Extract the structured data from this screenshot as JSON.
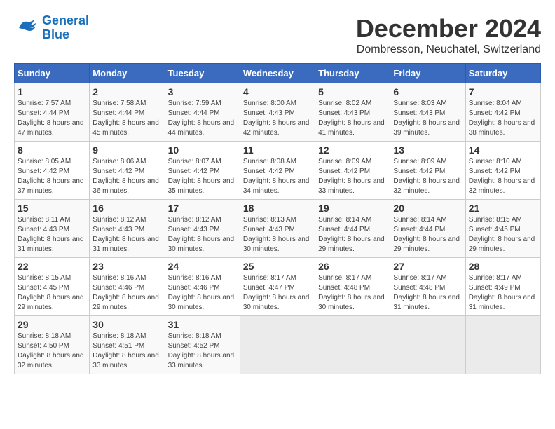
{
  "logo": {
    "line1": "General",
    "line2": "Blue"
  },
  "title": "December 2024",
  "location": "Dombresson, Neuchatel, Switzerland",
  "headers": [
    "Sunday",
    "Monday",
    "Tuesday",
    "Wednesday",
    "Thursday",
    "Friday",
    "Saturday"
  ],
  "weeks": [
    [
      {
        "day": "1",
        "sunrise": "7:57 AM",
        "sunset": "4:44 PM",
        "daylight": "8 hours and 47 minutes."
      },
      {
        "day": "2",
        "sunrise": "7:58 AM",
        "sunset": "4:44 PM",
        "daylight": "8 hours and 45 minutes."
      },
      {
        "day": "3",
        "sunrise": "7:59 AM",
        "sunset": "4:44 PM",
        "daylight": "8 hours and 44 minutes."
      },
      {
        "day": "4",
        "sunrise": "8:00 AM",
        "sunset": "4:43 PM",
        "daylight": "8 hours and 42 minutes."
      },
      {
        "day": "5",
        "sunrise": "8:02 AM",
        "sunset": "4:43 PM",
        "daylight": "8 hours and 41 minutes."
      },
      {
        "day": "6",
        "sunrise": "8:03 AM",
        "sunset": "4:43 PM",
        "daylight": "8 hours and 39 minutes."
      },
      {
        "day": "7",
        "sunrise": "8:04 AM",
        "sunset": "4:42 PM",
        "daylight": "8 hours and 38 minutes."
      }
    ],
    [
      {
        "day": "8",
        "sunrise": "8:05 AM",
        "sunset": "4:42 PM",
        "daylight": "8 hours and 37 minutes."
      },
      {
        "day": "9",
        "sunrise": "8:06 AM",
        "sunset": "4:42 PM",
        "daylight": "8 hours and 36 minutes."
      },
      {
        "day": "10",
        "sunrise": "8:07 AM",
        "sunset": "4:42 PM",
        "daylight": "8 hours and 35 minutes."
      },
      {
        "day": "11",
        "sunrise": "8:08 AM",
        "sunset": "4:42 PM",
        "daylight": "8 hours and 34 minutes."
      },
      {
        "day": "12",
        "sunrise": "8:09 AM",
        "sunset": "4:42 PM",
        "daylight": "8 hours and 33 minutes."
      },
      {
        "day": "13",
        "sunrise": "8:09 AM",
        "sunset": "4:42 PM",
        "daylight": "8 hours and 32 minutes."
      },
      {
        "day": "14",
        "sunrise": "8:10 AM",
        "sunset": "4:42 PM",
        "daylight": "8 hours and 32 minutes."
      }
    ],
    [
      {
        "day": "15",
        "sunrise": "8:11 AM",
        "sunset": "4:43 PM",
        "daylight": "8 hours and 31 minutes."
      },
      {
        "day": "16",
        "sunrise": "8:12 AM",
        "sunset": "4:43 PM",
        "daylight": "8 hours and 31 minutes."
      },
      {
        "day": "17",
        "sunrise": "8:12 AM",
        "sunset": "4:43 PM",
        "daylight": "8 hours and 30 minutes."
      },
      {
        "day": "18",
        "sunrise": "8:13 AM",
        "sunset": "4:43 PM",
        "daylight": "8 hours and 30 minutes."
      },
      {
        "day": "19",
        "sunrise": "8:14 AM",
        "sunset": "4:44 PM",
        "daylight": "8 hours and 29 minutes."
      },
      {
        "day": "20",
        "sunrise": "8:14 AM",
        "sunset": "4:44 PM",
        "daylight": "8 hours and 29 minutes."
      },
      {
        "day": "21",
        "sunrise": "8:15 AM",
        "sunset": "4:45 PM",
        "daylight": "8 hours and 29 minutes."
      }
    ],
    [
      {
        "day": "22",
        "sunrise": "8:15 AM",
        "sunset": "4:45 PM",
        "daylight": "8 hours and 29 minutes."
      },
      {
        "day": "23",
        "sunrise": "8:16 AM",
        "sunset": "4:46 PM",
        "daylight": "8 hours and 29 minutes."
      },
      {
        "day": "24",
        "sunrise": "8:16 AM",
        "sunset": "4:46 PM",
        "daylight": "8 hours and 30 minutes."
      },
      {
        "day": "25",
        "sunrise": "8:17 AM",
        "sunset": "4:47 PM",
        "daylight": "8 hours and 30 minutes."
      },
      {
        "day": "26",
        "sunrise": "8:17 AM",
        "sunset": "4:48 PM",
        "daylight": "8 hours and 30 minutes."
      },
      {
        "day": "27",
        "sunrise": "8:17 AM",
        "sunset": "4:48 PM",
        "daylight": "8 hours and 31 minutes."
      },
      {
        "day": "28",
        "sunrise": "8:17 AM",
        "sunset": "4:49 PM",
        "daylight": "8 hours and 31 minutes."
      }
    ],
    [
      {
        "day": "29",
        "sunrise": "8:18 AM",
        "sunset": "4:50 PM",
        "daylight": "8 hours and 32 minutes."
      },
      {
        "day": "30",
        "sunrise": "8:18 AM",
        "sunset": "4:51 PM",
        "daylight": "8 hours and 33 minutes."
      },
      {
        "day": "31",
        "sunrise": "8:18 AM",
        "sunset": "4:52 PM",
        "daylight": "8 hours and 33 minutes."
      },
      null,
      null,
      null,
      null
    ]
  ]
}
